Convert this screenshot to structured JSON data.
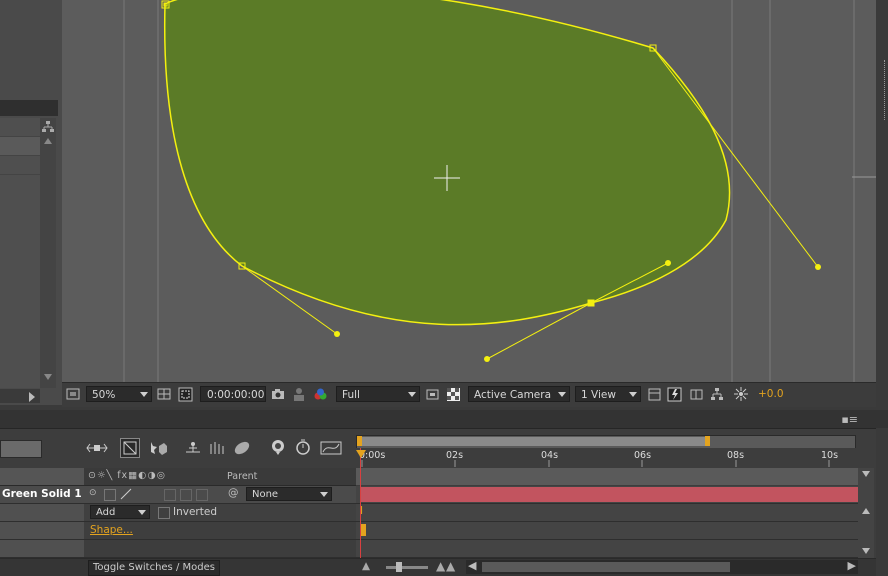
{
  "viewer": {
    "zoom": "50%",
    "timecode": "0:00:00:00",
    "resolution": "Full",
    "camera": "Active Camera",
    "views": "1 View",
    "exposure": "+0.0"
  },
  "timeline": {
    "ruler_labels": [
      "0:00s",
      "02s",
      "04s",
      "06s",
      "08s",
      "10s"
    ],
    "parent_header": "Parent",
    "layer_name": "Green Solid 1",
    "parent_value": "None",
    "mask_mode": "Add",
    "inverted_label": "Inverted",
    "shape_link": "Shape...",
    "toggle_label": "Toggle Switches / Modes"
  },
  "colors": {
    "mask_fill": "#5b7b27",
    "mask_stroke": "#f4f010",
    "layer_bar": "#c2545f",
    "accent": "#e3a31f"
  }
}
